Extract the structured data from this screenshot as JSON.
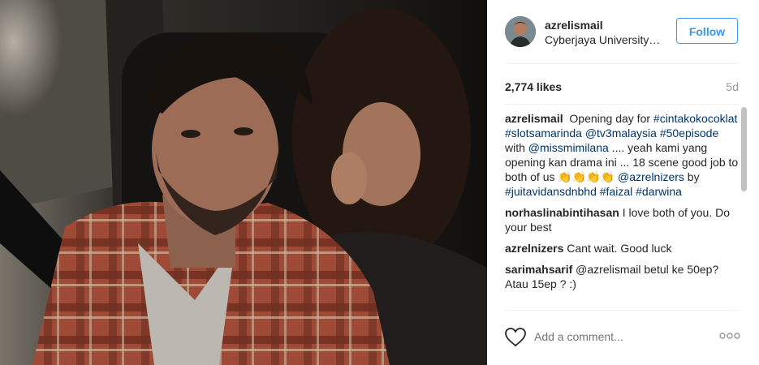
{
  "post": {
    "username": "azrelismail",
    "location": "Cyberjaya University…",
    "follow_label": "Follow",
    "likes": "2,774 likes",
    "age": "5d",
    "add_comment_placeholder": "Add a comment..."
  },
  "caption": {
    "user": "azrelismail",
    "segments": [
      {
        "text": "Opening day for ",
        "tag": false
      },
      {
        "text": "#cintakokocoklat",
        "tag": true
      },
      {
        "text": " ",
        "tag": false
      },
      {
        "text": "#slotsamarinda",
        "tag": true
      },
      {
        "text": " ",
        "tag": false
      },
      {
        "text": "@tv3malaysia",
        "tag": true
      },
      {
        "text": " ",
        "tag": false
      },
      {
        "text": "#50episode",
        "tag": true
      },
      {
        "text": " with ",
        "tag": false
      },
      {
        "text": "@missmimilana",
        "tag": true
      },
      {
        "text": " .... yeah kami yang opening kan drama ini ... 18 scene good job to both of us 👏👏👏👏 ",
        "tag": false
      },
      {
        "text": "@azrelnizers",
        "tag": true
      },
      {
        "text": " by ",
        "tag": false
      },
      {
        "text": "#juitavidansdnbhd",
        "tag": true
      },
      {
        "text": " ",
        "tag": false
      },
      {
        "text": "#faizal",
        "tag": true
      },
      {
        "text": " ",
        "tag": false
      },
      {
        "text": "#darwina",
        "tag": true
      }
    ]
  },
  "comments": [
    {
      "user": "norhaslinabintihasan",
      "text": "I love both of you. Do your best"
    },
    {
      "user": "azrelnizers",
      "text": "Cant wait. Good luck"
    },
    {
      "user": "sarimahsarif",
      "text": "@azrelismail betul ke 50ep? Atau 15ep ? :)"
    }
  ],
  "icons": {
    "heart": "heart-outline-icon",
    "more": "more-options-icon"
  },
  "colors": {
    "accent": "#3897f0",
    "tag": "#003569",
    "muted": "#999999"
  }
}
